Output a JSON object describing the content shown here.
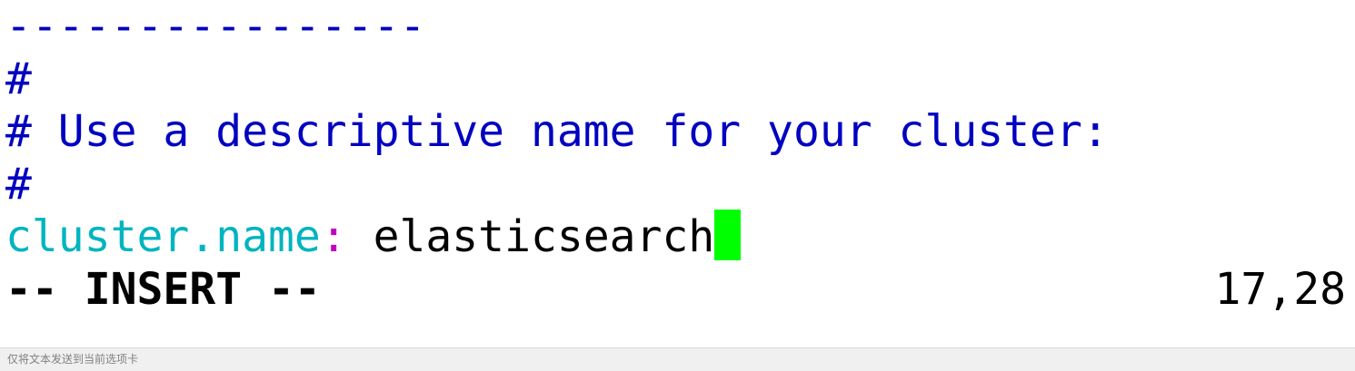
{
  "editor": {
    "lines": [
      {
        "text": "----------------"
      },
      {
        "text": "#"
      },
      {
        "text": "# Use a descriptive name for your cluster:"
      },
      {
        "text": "#"
      }
    ],
    "config_line": {
      "key": "cluster.name",
      "colon": ":",
      "value": " elasticsearch"
    },
    "mode_text": "-- INSERT --",
    "cursor_position": "17,28",
    "colors": {
      "comment": "#0000c0",
      "key": "#00b4c0",
      "colon": "#c000c0",
      "cursor": "#00ff00"
    }
  },
  "statusbar": {
    "hint": "仅将文本发送到当前选项卡"
  }
}
